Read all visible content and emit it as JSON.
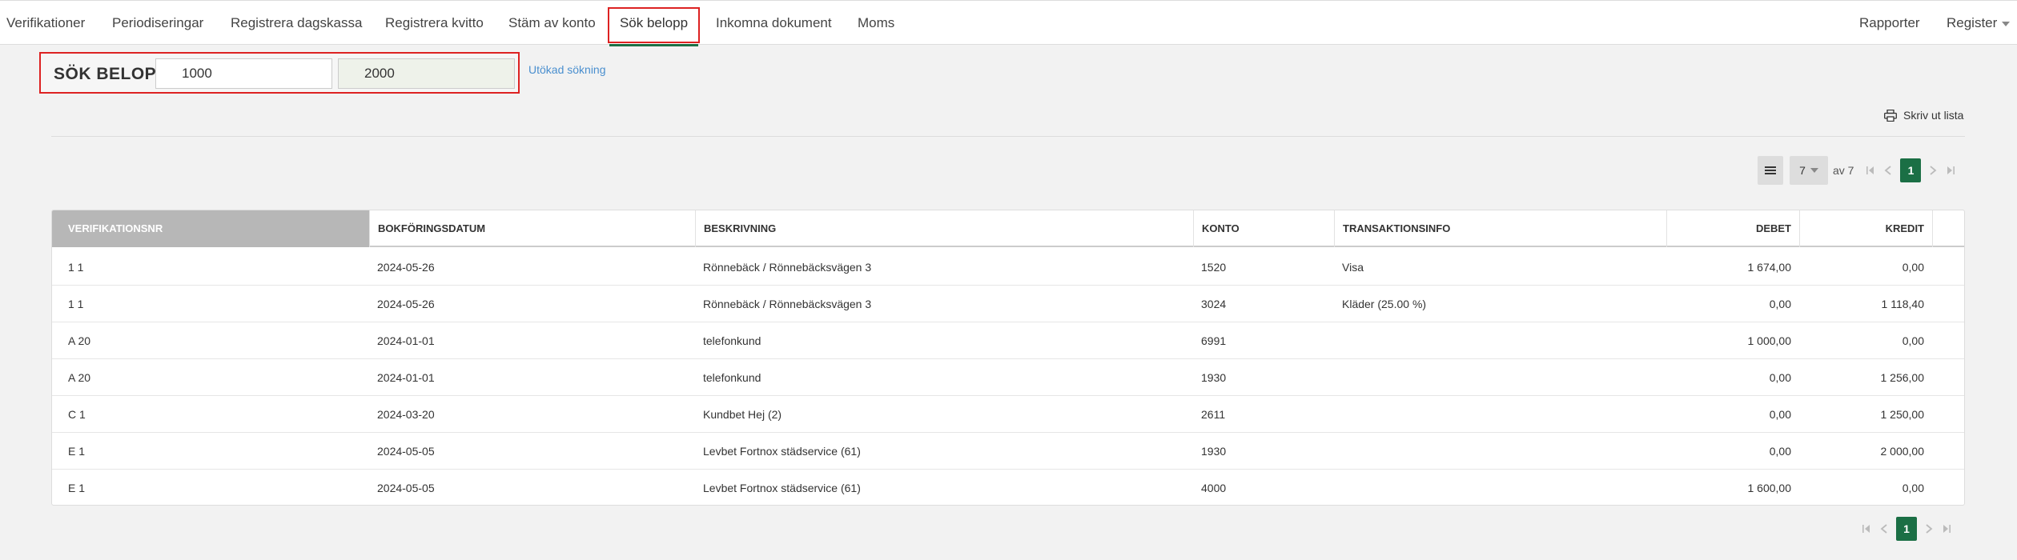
{
  "nav": {
    "tabs": [
      {
        "label": "Verifikationer"
      },
      {
        "label": "Periodiseringar"
      },
      {
        "label": "Registrera dagskassa"
      },
      {
        "label": "Registrera kvitto"
      },
      {
        "label": "Stäm av konto"
      },
      {
        "label": "Sök belopp",
        "active": true
      },
      {
        "label": "Inkomna dokument"
      },
      {
        "label": "Moms"
      }
    ],
    "right": {
      "rapporter": "Rapporter",
      "register": "Register"
    },
    "accent_color": "#1b6f45"
  },
  "search": {
    "label": "SÖK BELOPP",
    "from_value": "1000",
    "to_value": "2000",
    "advanced_link": "Utökad sökning"
  },
  "toolbar": {
    "print_label": "Skriv ut lista"
  },
  "pagination": {
    "page_size": "7",
    "of_label": "av 7",
    "current_page": "1"
  },
  "table": {
    "columns": [
      "VERIFIKATIONSNR",
      "BOKFÖRINGSDATUM",
      "BESKRIVNING",
      "KONTO",
      "TRANSAKTIONSINFO",
      "DEBET",
      "KREDIT"
    ],
    "rows": [
      {
        "ver": "1 1",
        "datum": "2024-05-26",
        "beskrivning": "Rönnebäck / Rönnebäcksvägen 3",
        "konto": "1520",
        "info": "Visa",
        "debet": "1 674,00",
        "kredit": "0,00"
      },
      {
        "ver": "1 1",
        "datum": "2024-05-26",
        "beskrivning": "Rönnebäck / Rönnebäcksvägen 3",
        "konto": "3024",
        "info": "Kläder (25.00 %)",
        "debet": "0,00",
        "kredit": "1 118,40"
      },
      {
        "ver": "A 20",
        "datum": "2024-01-01",
        "beskrivning": "telefonkund",
        "konto": "6991",
        "info": "",
        "debet": "1 000,00",
        "kredit": "0,00"
      },
      {
        "ver": "A 20",
        "datum": "2024-01-01",
        "beskrivning": "telefonkund",
        "konto": "1930",
        "info": "",
        "debet": "0,00",
        "kredit": "1 256,00"
      },
      {
        "ver": "C 1",
        "datum": "2024-03-20",
        "beskrivning": "Kundbet Hej (2)",
        "konto": "2611",
        "info": "",
        "debet": "0,00",
        "kredit": "1 250,00"
      },
      {
        "ver": "E 1",
        "datum": "2024-05-05",
        "beskrivning": "Levbet Fortnox städservice (61)",
        "konto": "1930",
        "info": "",
        "debet": "0,00",
        "kredit": "2 000,00"
      },
      {
        "ver": "E 1",
        "datum": "2024-05-05",
        "beskrivning": "Levbet Fortnox städservice (61)",
        "konto": "4000",
        "info": "",
        "debet": "1 600,00",
        "kredit": "0,00"
      }
    ]
  }
}
